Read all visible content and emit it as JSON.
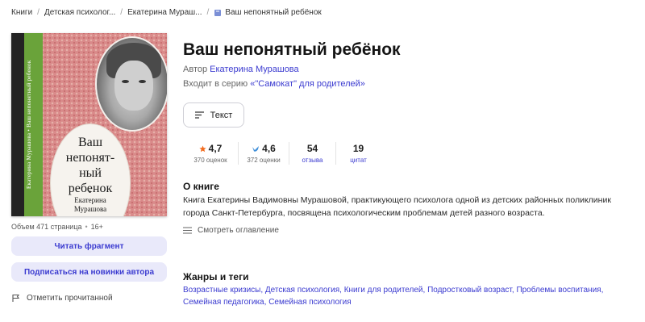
{
  "breadcrumb": {
    "items": [
      "Книги",
      "Детская психолог...",
      "Екатерина Мураш...",
      "Ваш непонятный ребёнок"
    ],
    "current_icon": "book-icon"
  },
  "cover": {
    "title": "Ваш непонятный ребенок",
    "title_lines": [
      "Ваш",
      "непонят-",
      "ный",
      "ребенок"
    ],
    "author_lines": [
      "Екатерина",
      "Мурашова"
    ],
    "spine": "Екатерина Мурашова • Ваш непонятный ребенок"
  },
  "meta": {
    "volume": "Объем 471 страница",
    "age": "16+"
  },
  "actions": {
    "read_fragment": "Читать фрагмент",
    "subscribe_author": "Подписаться на новинки автора",
    "mark_read": "Отметить прочитанной"
  },
  "book": {
    "title": "Ваш непонятный ребёнок",
    "author_prefix": "Автор",
    "author": "Екатерина Мурашова",
    "series_prefix": "Входит в серию",
    "series": "«\"Самокат\" для родителей»",
    "format_label": "Текст"
  },
  "stats": [
    {
      "value": "4,7",
      "label": "370 оценок",
      "icon": "star-icon"
    },
    {
      "value": "4,6",
      "label": "372 оценки",
      "icon": "bird-icon"
    },
    {
      "value": "54",
      "label": "отзыва",
      "icon": ""
    },
    {
      "value": "19",
      "label": "цитат",
      "icon": ""
    }
  ],
  "colors": {
    "accent": "#3b3bd0",
    "star": "#f26b1d",
    "soft_button": "#e9e9fa"
  },
  "about": {
    "heading": "О книге",
    "text": "Книга Екатерины Вадимовны Мурашовой, практикующего психолога одной из детских районных поликлиник города Санкт-Петербурга, посвящена психологическим проблемам детей разного возраста.",
    "toc_label": "Смотреть оглавление"
  },
  "genres": {
    "heading": "Жанры и теги",
    "items": [
      "Возрастные кризисы",
      "Детская психология",
      "Книги для родителей",
      "Подростковый возраст",
      "Проблемы воспитания",
      "Семейная педагогика",
      "Семейная психология"
    ]
  }
}
